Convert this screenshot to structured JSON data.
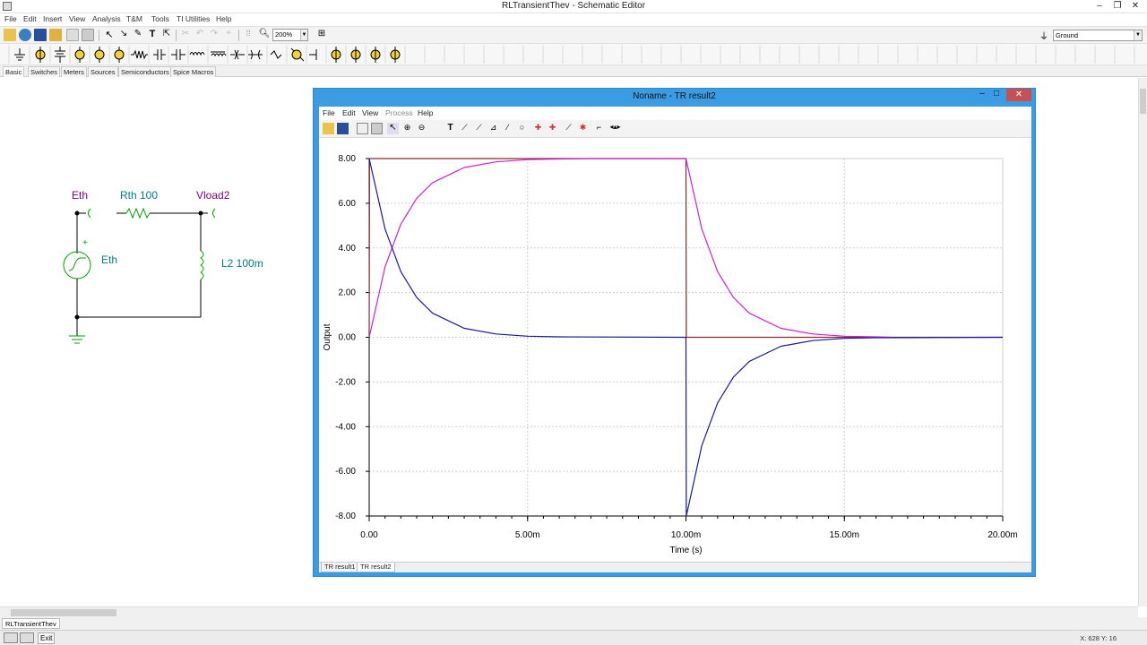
{
  "app": {
    "title": "RLTransientThev - Schematic Editor"
  },
  "menu": [
    "File",
    "Edit",
    "Insert",
    "View",
    "Analysis",
    "T&M",
    "Tools",
    "TI Utilities",
    "Help"
  ],
  "toolbar": {
    "zoom": "200%",
    "ground_select": "Ground"
  },
  "component_tabs": [
    "Basic",
    "Switches",
    "Meters",
    "Sources",
    "Semiconductors",
    "Spice Macros"
  ],
  "schematic": {
    "labels": {
      "eth_node": "Eth",
      "rth": "Rth 100",
      "vload": "Vload2",
      "source": "Eth",
      "inductor": "L2 100m",
      "plus": "+"
    }
  },
  "result_window": {
    "title": "Noname - TR result2",
    "menu": [
      "File",
      "Edit",
      "View",
      "Process",
      "Help"
    ],
    "tabs": [
      "TR result1",
      "TR result2"
    ]
  },
  "chart_data": {
    "type": "line",
    "xlabel": "Time (s)",
    "ylabel": "Output",
    "xlim": [
      0,
      0.02
    ],
    "ylim": [
      -8,
      8
    ],
    "x_ticks": [
      "0.00",
      "5.00m",
      "10.00m",
      "15.00m",
      "20.00m"
    ],
    "y_ticks": [
      "8.00",
      "6.00",
      "4.00",
      "2.00",
      "0.00",
      "-2.00",
      "-4.00",
      "-6.00",
      "-8.00"
    ],
    "grid": true,
    "series": [
      {
        "color": "#8b2a2a",
        "x": [
          0,
          1e-05,
          0.01,
          0.01001,
          0.02
        ],
        "y": [
          0,
          8,
          8,
          0,
          0
        ]
      },
      {
        "color": "#d020d0",
        "x": [
          0,
          0.0005,
          0.001,
          0.0015,
          0.002,
          0.003,
          0.004,
          0.005,
          0.006,
          0.007,
          0.01,
          0.0105,
          0.011,
          0.0115,
          0.012,
          0.013,
          0.014,
          0.015,
          0.016,
          0.0165
        ],
        "y": [
          0,
          3.15,
          5.06,
          6.22,
          6.92,
          7.6,
          7.85,
          7.95,
          7.98,
          8.0,
          8.0,
          4.85,
          2.94,
          1.78,
          1.08,
          0.4,
          0.15,
          0.05,
          0.02,
          0.0
        ]
      },
      {
        "color": "#1a1aa0",
        "x": [
          0,
          0.0005,
          0.001,
          0.0015,
          0.002,
          0.003,
          0.004,
          0.005,
          0.006,
          0.01,
          0.01001,
          0.0105,
          0.011,
          0.0115,
          0.012,
          0.013,
          0.014,
          0.015,
          0.016,
          0.02
        ],
        "y": [
          8,
          4.85,
          2.94,
          1.78,
          1.08,
          0.4,
          0.15,
          0.05,
          0.02,
          0.0,
          -8,
          -4.85,
          -2.94,
          -1.78,
          -1.08,
          -0.4,
          -0.15,
          -0.05,
          -0.02,
          0.0
        ]
      }
    ]
  },
  "doc_tab": "RLTransientThev",
  "status": {
    "exit": "Exit",
    "coords": "X: 628  Y: 16"
  }
}
